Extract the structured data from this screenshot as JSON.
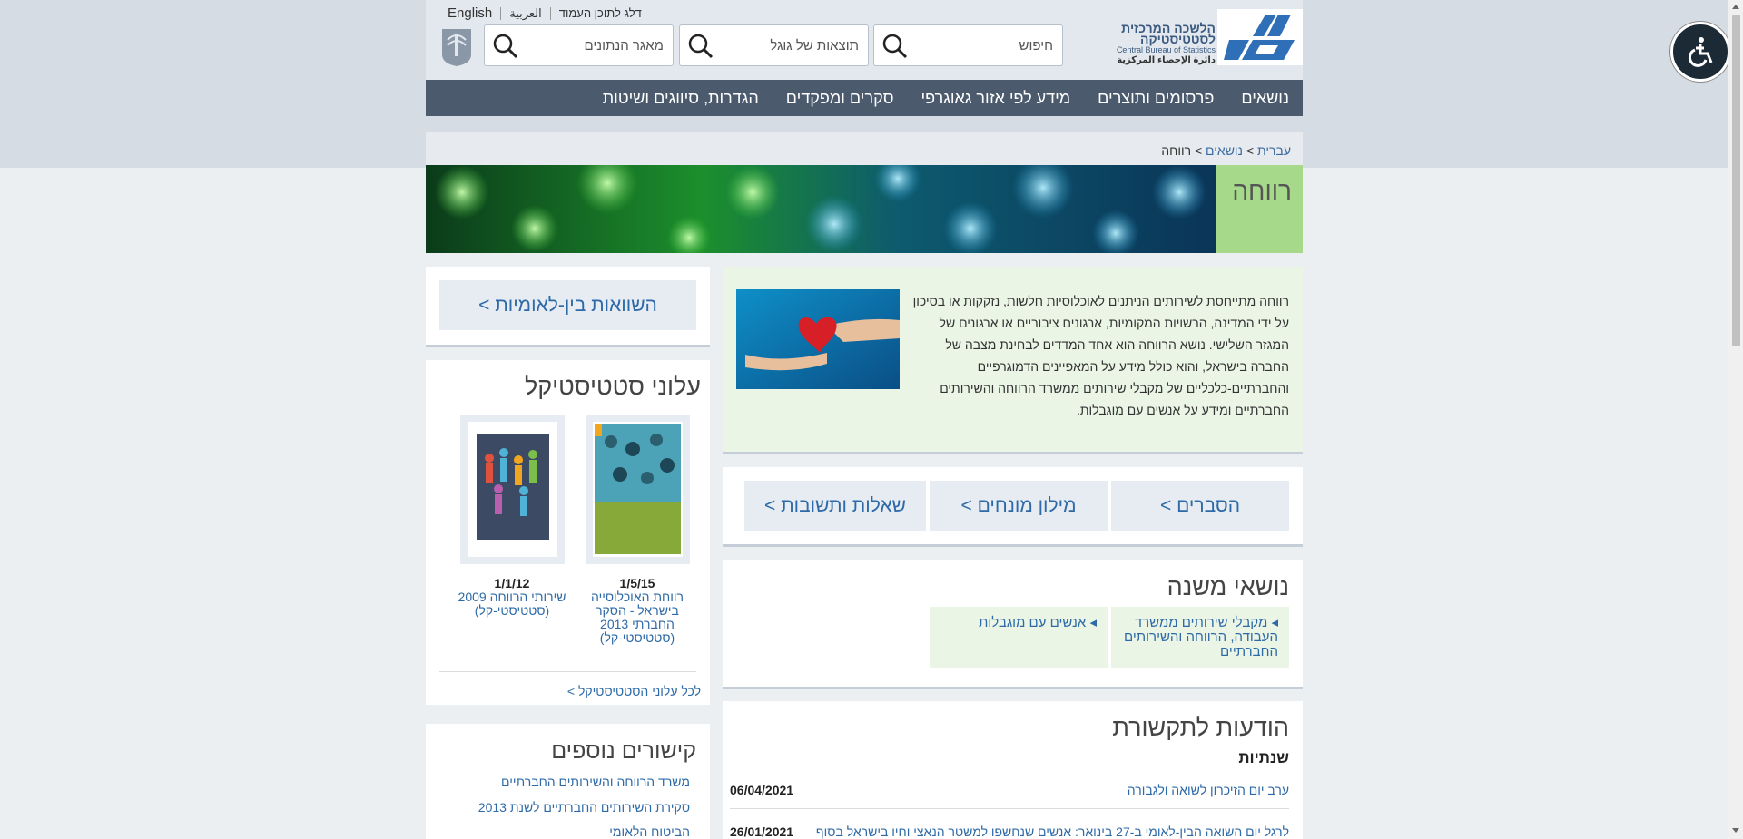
{
  "header": {
    "logo_he": "הלשכה המרכזית לסטטיסטיקה",
    "logo_en": "Central Bureau of Statistics",
    "logo_ar": "دائرة الإحصاء المركزية",
    "search_placeholder": "חיפוש",
    "google_placeholder": "תוצאות של גוגל",
    "data_placeholder": "מאגר הנתונים",
    "skip_link": "דלג לתוכן העמוד",
    "lang_ar": "العربية",
    "lang_en": "English"
  },
  "nav": {
    "items": [
      "נושאים",
      "פרסומים ותוצרים",
      "מידע לפי אזור גאוגרפי",
      "סקרים ומפקדים",
      "הגדרות, סיווגים ושיטות"
    ]
  },
  "breadcrumb": {
    "home": "עברית",
    "sep1": " > ",
    "topics": "נושאים",
    "sep2": " > ",
    "current": "רווחה"
  },
  "banner": {
    "title": "רווחה"
  },
  "intro": {
    "text": "רווחה מתייחסת לשירותים הניתנים לאוכלוסיות חלשות, נזקקות או בסיכון על ידי המדינה, הרשויות המקומיות, ארגונים ציבוריים או ארגונים של המגזר השלישי. נושא הרווחה הוא אחד המדדים לבחינת מצבה של החברה בישראל, והוא כולל מידע על המאפיינים הדמוגרפיים והחברתיים-כלכליים של מקבלי שירותים ממשרד הרווחה והשירותים החברתיים ומידע על אנשים עם מוגבלות."
  },
  "buttons": {
    "explanations": "הסברים >",
    "glossary": "מילון מונחים >",
    "faq": "שאלות ותשובות >"
  },
  "subtopics": {
    "title": "נושאי משנה",
    "items": [
      "מקבלי שירותים ממשרד העבודה, הרווחה והשירותים החברתיים",
      "אנשים עם מוגבלות"
    ]
  },
  "media": {
    "title": "הודעות לתקשורת",
    "subtitle": "שנתיות",
    "items": [
      {
        "title": "ערב יום הזיכרון לשואה ולגבורה",
        "date": "06/04/2021"
      },
      {
        "title": "לרגל יום השואה הבין-לאומי ב-27 בינואר: אנשים שנחשפו למשטר הנאצי וחיו בישראל בסוף",
        "date": "26/01/2021"
      }
    ]
  },
  "intl": {
    "label": "השוואות בין-לאומיות >"
  },
  "statistical": {
    "title": "עלוני סטטיסטיקל",
    "pubs": [
      {
        "date": "1/5/15",
        "title": "רווחת האוכלוסייה בישראל - הסקר החברתי 2013 (סטטיסטי-קל)"
      },
      {
        "date": "1/1/12",
        "title": "שירותי הרווחה 2009 (סטטיסטי-קל)"
      }
    ],
    "all_link": "לכל עלוני הסטטיסטיקל >"
  },
  "links": {
    "title": "קישורים נוספים",
    "items": [
      "משרד הרווחה והשירותים החברתיים",
      "סקירת השירותים החברתיים לשנת 2013",
      "הביטוח הלאומי"
    ]
  },
  "colors": {
    "nav_bg": "#4b5a6c",
    "link": "#2e6aa7",
    "green_tile": "#eaf5e6",
    "banner_title_bg": "#a6d98a"
  }
}
